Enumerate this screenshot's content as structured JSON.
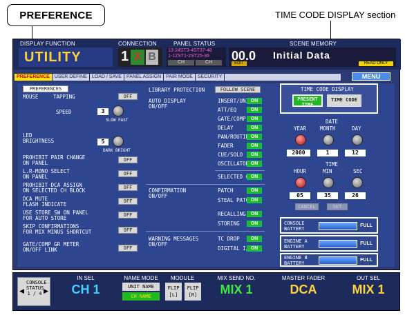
{
  "callouts": {
    "preference": "PREFERENCE",
    "time_code": "TIME CODE DISPLAY section"
  },
  "header": {
    "display_function_label": "DISPLAY FUNCTION",
    "display_function": "UTILITY",
    "connection_label": "CONNECTION",
    "connection_num": "1",
    "conn_x": "X",
    "conn_b": "B",
    "panel_status_label": "PANEL STATUS",
    "ps_line1": "13-24ST3-4ST37-48",
    "ps_line2": "1-12ST1-2ST25-36",
    "ps_ch1": "CH",
    "ps_ch2": "CH",
    "scene_memory_label": "SCENE MEMORY",
    "scene_num": "00.0",
    "scene_name": "Initial Data",
    "edit": "EDIT",
    "read_only": "READ ONLY"
  },
  "tabs": [
    "PREFERENCE",
    "USER DEFINE",
    "LOAD / SAVE",
    "PANEL ASSIGN",
    "PAIR MODE",
    "SECURITY"
  ],
  "menu": "MENU",
  "left": {
    "title": "PREFERENCES",
    "mouse": "MOUSE",
    "tapping": "TAPPING",
    "off": "OFF",
    "speed": "SPEED",
    "speed_val": "3",
    "slow_fast": "SLOW FAST",
    "led": "LED",
    "brightness": "BRIGHTNESS",
    "led_val": "5",
    "dark_bright": "DARK BRIGHT",
    "p1a": "PROHIBIT PAIR CHANGE",
    "p1b": "ON PANEL",
    "p2a": "L.R-MONO SELECT",
    "p2b": "ON PANEL",
    "p3a": "PROHIBIT DCA ASSIGN",
    "p3b": "ON SELECTED CH BLOCK",
    "p4a": "DCA MUTE",
    "p4b": "FLASH INDICATE",
    "p5a": "USE STORE SW ON PANEL",
    "p5b": "FOR AUTO STORE",
    "p6a": "SKIP CONFIRMATIONS",
    "p6b": "FOR MIX MINUS SHORTCUT",
    "p7a": "GATE/COMP GR METER",
    "p7b": "ON/OFF LINK"
  },
  "mid": {
    "lib": "LIBRARY PROTECTION",
    "follow": "FOLLOW SCENE",
    "auto": "AUTO DISPLAY",
    "onoff": "ON/OFF",
    "items": [
      "INSERT/UNIT",
      "ATT/EQ",
      "GATE/COMP",
      "DELAY",
      "PAN/ROUTING",
      "FADER",
      "CUE/SOLO",
      "OSCILLATOR"
    ],
    "selected": "SELECTED CH",
    "on": "ON",
    "confirm": "CONFIRMATION",
    "patch": "PATCH",
    "steal": "STEAL PATCH",
    "recall": "RECALLING",
    "storing": "STORING",
    "warn": "WARNING MESSAGES",
    "tc_drop": "TC DROP",
    "dio": "DIGITAL I/O"
  },
  "right": {
    "tcd": "TIME CODE DISPLAY",
    "present": "PRESENT",
    "time": "TIME",
    "time_code": "TIME CODE",
    "date": "DATE",
    "year": "YEAR",
    "month": "MONTH",
    "day": "DAY",
    "y": "2000",
    "m": "1",
    "d": "12",
    "time_t": "TIME",
    "hour": "HOUR",
    "min": "MIN",
    "sec": "SEC",
    "h": "05",
    "mi": "35",
    "s": "26",
    "cancel": "CANCEL",
    "set": "SET",
    "cb1": "CONSOLE",
    "cb2": "BATTERY",
    "ea1": "ENGINE A",
    "ea2": "BATTERY",
    "eb1": "ENGINE B",
    "eb2": "BATTERY",
    "full": "FULL"
  },
  "footer": {
    "console_status": "CONSOLE",
    "status": "STATUS",
    "page": "1 / 4",
    "in_sel_l": "IN SEL",
    "in_sel": "CH 1",
    "name_mode": "NAME MODE",
    "unit_name": "UNIT NAME",
    "ch_name": "CH NAME",
    "module": "MODULE",
    "flip_l": "FLIP",
    "flip_l2": "[L]",
    "flip_r": "FLIP",
    "flip_r2": "[R]",
    "mix_send_l": "MIX SEND NO.",
    "mix_send": "MIX 1",
    "master_l": "MASTER FADER",
    "master": "DCA",
    "out_l": "OUT SEL",
    "out": "MIX 1"
  }
}
